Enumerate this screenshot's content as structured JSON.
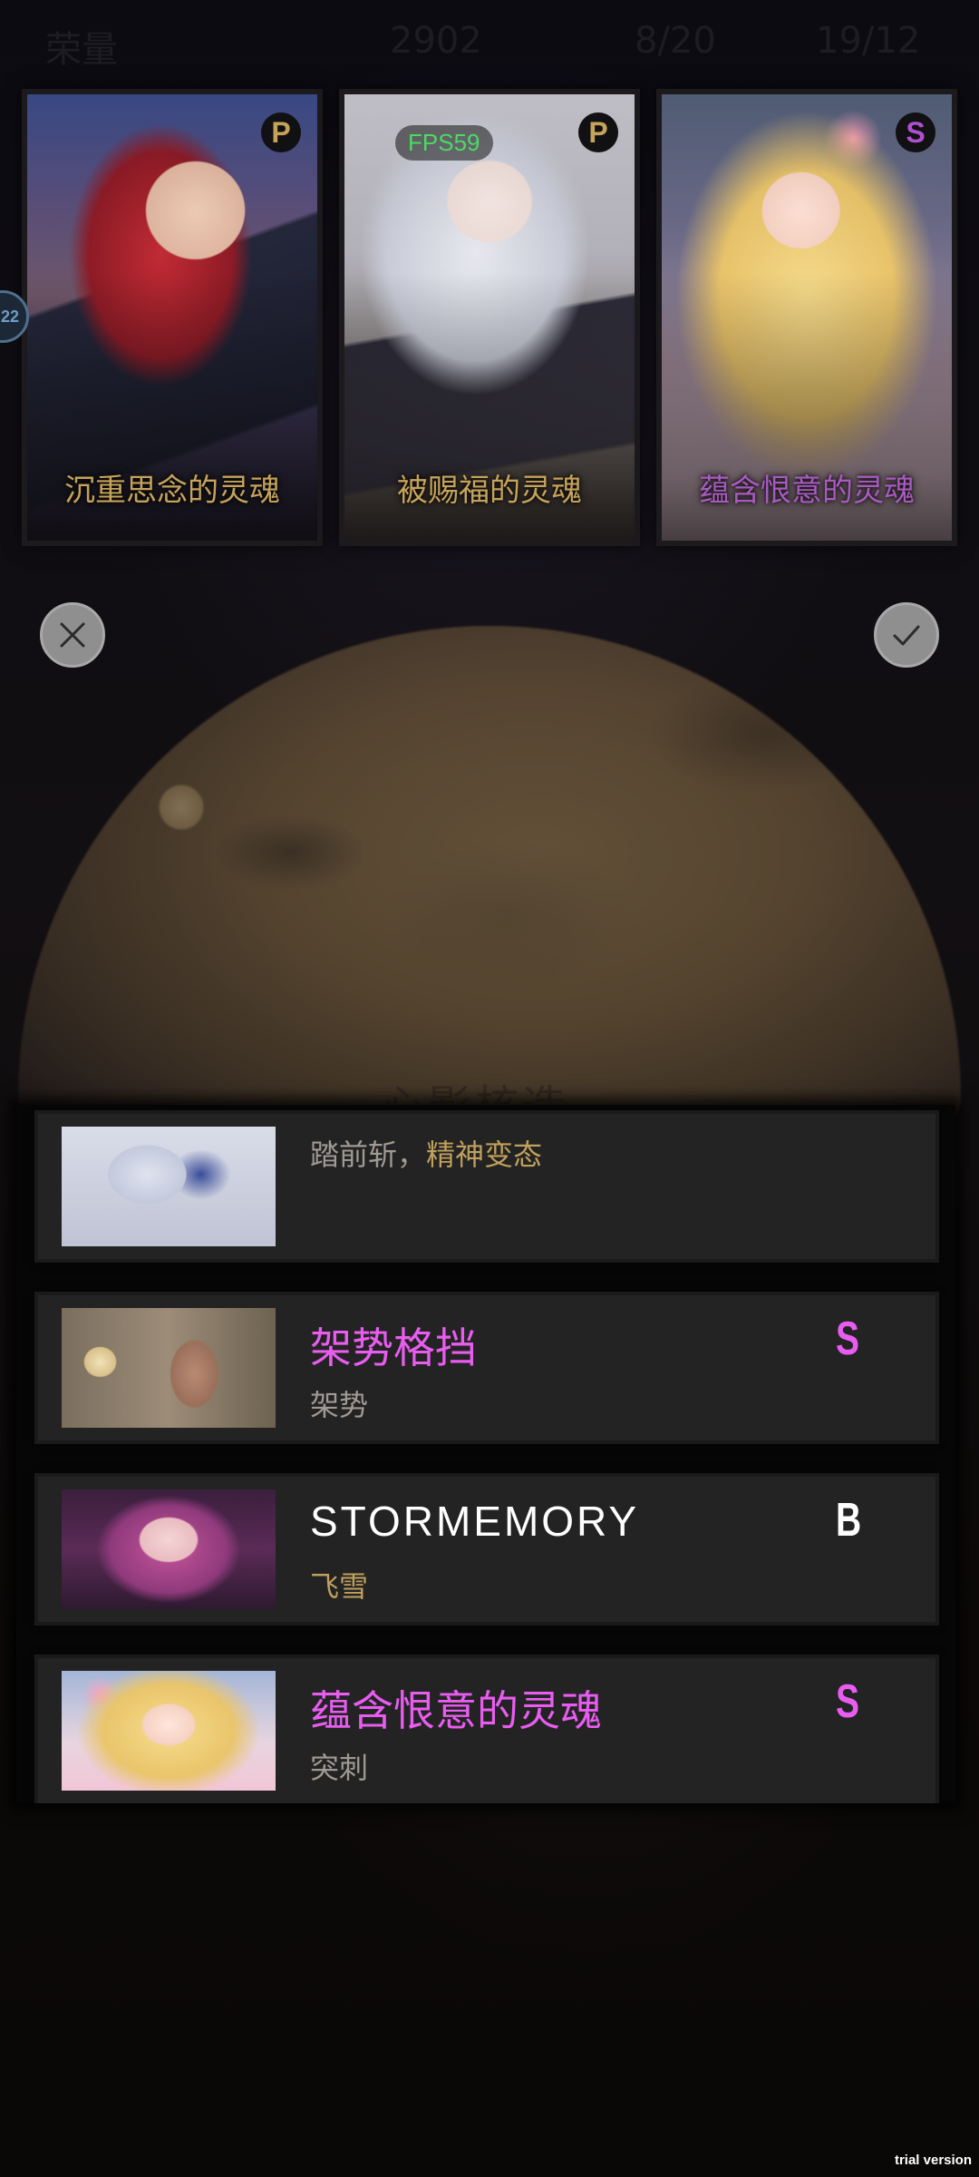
{
  "status_bar": {
    "left": "荣量",
    "center": "2902",
    "mid": "8/20",
    "right": "19/12"
  },
  "fps_label": "FPS59",
  "edge_tab_label": "22",
  "top_cards": [
    {
      "name": "沉重思念的灵魂",
      "rank": "P",
      "rank_color": "#c6a35a"
    },
    {
      "name": "被赐福的灵魂",
      "rank": "P",
      "rank_color": "#c6a35a"
    },
    {
      "name": "蕴含恨意的灵魂",
      "rank": "S",
      "rank_color": "#b04fd0"
    }
  ],
  "actions": {
    "cancel_icon": "close-icon",
    "confirm_icon": "check-icon"
  },
  "background_title": "心影核造",
  "list_rows": [
    {
      "title": "",
      "subtitle_plain": "踏前斩，",
      "subtitle_highlight": "精神变态",
      "rank": ""
    },
    {
      "title": "架势格挡",
      "subtitle_plain": "架势",
      "subtitle_highlight": "",
      "rank": "S"
    },
    {
      "title": "STORMEMORY",
      "subtitle_plain": "",
      "subtitle_highlight": "飞雪",
      "rank": "B"
    },
    {
      "title": "蕴含恨意的灵魂",
      "subtitle_plain": "突刺",
      "subtitle_highlight": "",
      "rank": "S"
    }
  ],
  "watermark": "trial version",
  "colors": {
    "rank_p": "#c6a35a",
    "rank_s": "#e85df0",
    "rank_b": "#ffffff",
    "highlight_gold": "#bfa05c",
    "fps_green": "#4cd964"
  }
}
